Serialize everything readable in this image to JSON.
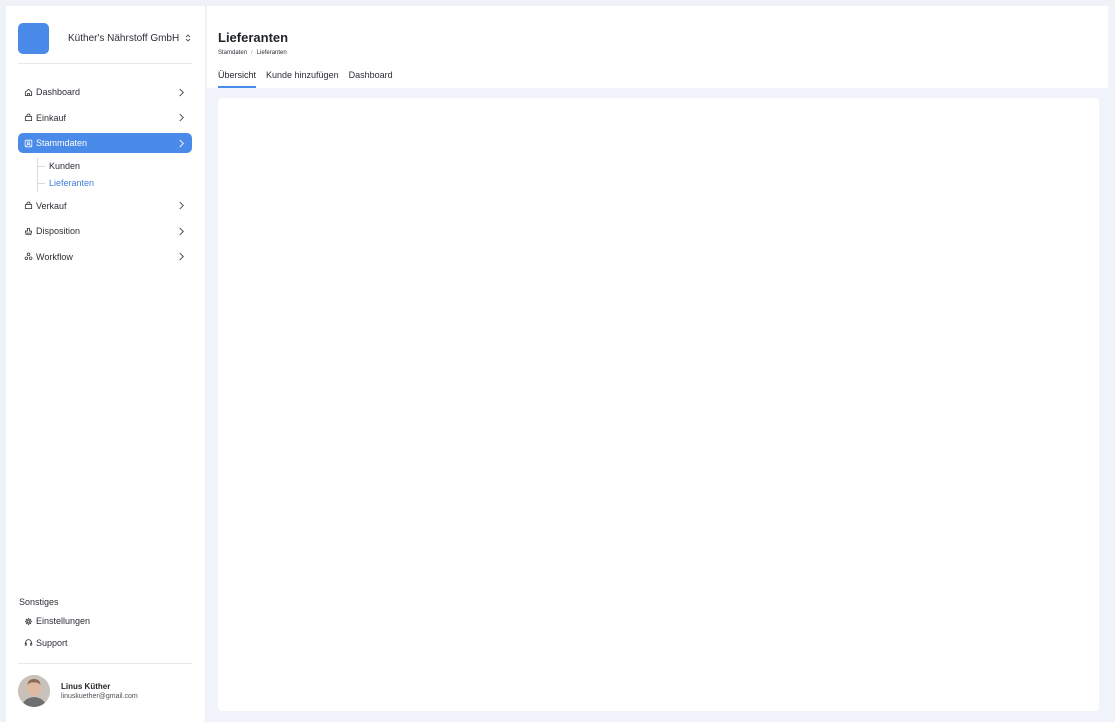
{
  "company": {
    "name": "Küther's Nährstoff GmbH"
  },
  "nav": {
    "items": [
      {
        "label": "Dashboard",
        "icon": "home-icon"
      },
      {
        "label": "Einkauf",
        "icon": "bag-icon"
      },
      {
        "label": "Stammdaten",
        "icon": "contact-card-icon",
        "active": true
      },
      {
        "label": "Verkauf",
        "icon": "bag-icon"
      },
      {
        "label": "Disposition",
        "icon": "stamp-icon"
      },
      {
        "label": "Workflow",
        "icon": "nodes-icon"
      }
    ],
    "subitems": [
      {
        "label": "Kunden"
      },
      {
        "label": "Lieferanten",
        "active": true
      }
    ]
  },
  "other": {
    "label": "Sonstiges",
    "items": [
      {
        "label": "Einstellungen",
        "icon": "gear-icon"
      },
      {
        "label": "Support",
        "icon": "headset-icon"
      }
    ]
  },
  "user": {
    "name": "Linus Küther",
    "email": "linuskuether@gmail.com"
  },
  "header": {
    "title": "Lieferanten",
    "breadcrumb": [
      "Stamdaten",
      "Lieferanten"
    ],
    "tabs": [
      {
        "label": "Übersicht",
        "active": true
      },
      {
        "label": "Kunde hinzufügen"
      },
      {
        "label": "Dashboard"
      }
    ]
  },
  "colors": {
    "accent": "#4a8ae8",
    "background": "#f0f4fa",
    "active_sub": "#3f7fd9"
  }
}
